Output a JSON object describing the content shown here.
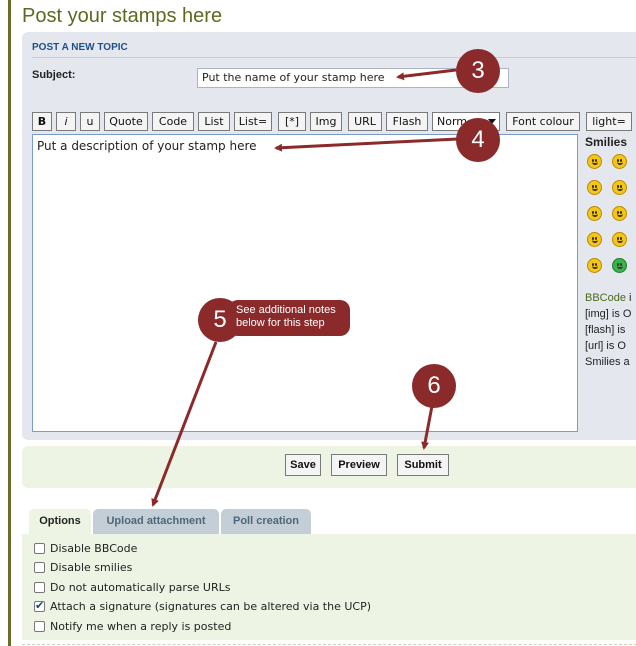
{
  "page": {
    "title": "Post your stamps here"
  },
  "post_panel": {
    "heading": "POST A NEW TOPIC",
    "subject_label": "Subject:",
    "subject_value": "Put the name of your stamp here",
    "message_value": "Put a description of your stamp here"
  },
  "toolbar": {
    "bold": "B",
    "italic": "i",
    "underline": "u",
    "quote": "Quote",
    "code": "Code",
    "list": "List",
    "list_ordered": "List=",
    "list_item": "[*]",
    "img": "Img",
    "url": "URL",
    "flash": "Flash",
    "font_size_selected": "Norm",
    "font_colour": "Font colour",
    "help_line": "light="
  },
  "smilies": {
    "title": "Smilies",
    "icons": [
      "very-happy-smiley-icon",
      "smile-smiley-icon",
      "surprised-smiley-icon",
      "shocked-smiley-icon",
      "laughing-smiley-icon",
      "confused-smiley-icon",
      "cool-smiley-icon",
      "exclamation-smiley-icon",
      "neutral-smiley-icon",
      "green-grin-smiley-icon"
    ]
  },
  "bbcode_info": {
    "line1_prefix": "BBCode",
    "line1_suffix": " i",
    "line2": "[img] is O",
    "line3": "[flash] is",
    "line4": "[url] is O",
    "line5": "Smilies a"
  },
  "submit_buttons": {
    "save": "Save",
    "preview": "Preview",
    "submit": "Submit"
  },
  "tabs": [
    {
      "label": "Options",
      "active": true
    },
    {
      "label": "Upload attachment",
      "active": false
    },
    {
      "label": "Poll creation",
      "active": false
    }
  ],
  "options": [
    {
      "label": "Disable BBCode",
      "checked": false
    },
    {
      "label": "Disable smilies",
      "checked": false
    },
    {
      "label": "Do not automatically parse URLs",
      "checked": false
    },
    {
      "label": "Attach a signature (signatures can be altered via the UCP)",
      "checked": true
    },
    {
      "label": "Notify me when a reply is posted",
      "checked": false
    }
  ],
  "annotations": {
    "step3": "3",
    "step4": "4",
    "step5": "5",
    "step5_note": "See additional notes below for this step",
    "step6": "6",
    "color": "#8b2a2a"
  }
}
